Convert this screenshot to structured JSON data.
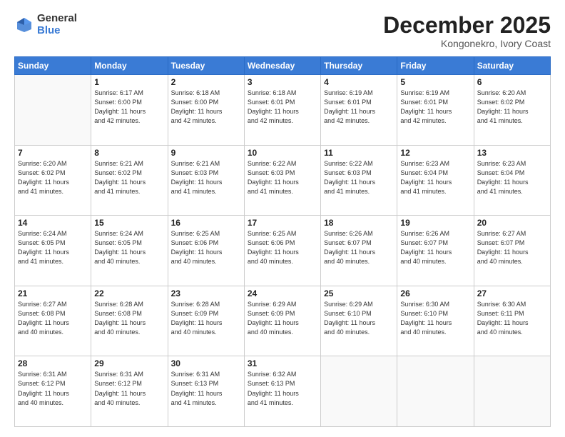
{
  "logo": {
    "general": "General",
    "blue": "Blue"
  },
  "header": {
    "month": "December 2025",
    "location": "Kongonekro, Ivory Coast"
  },
  "days_of_week": [
    "Sunday",
    "Monday",
    "Tuesday",
    "Wednesday",
    "Thursday",
    "Friday",
    "Saturday"
  ],
  "weeks": [
    [
      {
        "day": "",
        "info": ""
      },
      {
        "day": "1",
        "info": "Sunrise: 6:17 AM\nSunset: 6:00 PM\nDaylight: 11 hours\nand 42 minutes."
      },
      {
        "day": "2",
        "info": "Sunrise: 6:18 AM\nSunset: 6:00 PM\nDaylight: 11 hours\nand 42 minutes."
      },
      {
        "day": "3",
        "info": "Sunrise: 6:18 AM\nSunset: 6:01 PM\nDaylight: 11 hours\nand 42 minutes."
      },
      {
        "day": "4",
        "info": "Sunrise: 6:19 AM\nSunset: 6:01 PM\nDaylight: 11 hours\nand 42 minutes."
      },
      {
        "day": "5",
        "info": "Sunrise: 6:19 AM\nSunset: 6:01 PM\nDaylight: 11 hours\nand 42 minutes."
      },
      {
        "day": "6",
        "info": "Sunrise: 6:20 AM\nSunset: 6:02 PM\nDaylight: 11 hours\nand 41 minutes."
      }
    ],
    [
      {
        "day": "7",
        "info": "Sunrise: 6:20 AM\nSunset: 6:02 PM\nDaylight: 11 hours\nand 41 minutes."
      },
      {
        "day": "8",
        "info": "Sunrise: 6:21 AM\nSunset: 6:02 PM\nDaylight: 11 hours\nand 41 minutes."
      },
      {
        "day": "9",
        "info": "Sunrise: 6:21 AM\nSunset: 6:03 PM\nDaylight: 11 hours\nand 41 minutes."
      },
      {
        "day": "10",
        "info": "Sunrise: 6:22 AM\nSunset: 6:03 PM\nDaylight: 11 hours\nand 41 minutes."
      },
      {
        "day": "11",
        "info": "Sunrise: 6:22 AM\nSunset: 6:03 PM\nDaylight: 11 hours\nand 41 minutes."
      },
      {
        "day": "12",
        "info": "Sunrise: 6:23 AM\nSunset: 6:04 PM\nDaylight: 11 hours\nand 41 minutes."
      },
      {
        "day": "13",
        "info": "Sunrise: 6:23 AM\nSunset: 6:04 PM\nDaylight: 11 hours\nand 41 minutes."
      }
    ],
    [
      {
        "day": "14",
        "info": "Sunrise: 6:24 AM\nSunset: 6:05 PM\nDaylight: 11 hours\nand 41 minutes."
      },
      {
        "day": "15",
        "info": "Sunrise: 6:24 AM\nSunset: 6:05 PM\nDaylight: 11 hours\nand 40 minutes."
      },
      {
        "day": "16",
        "info": "Sunrise: 6:25 AM\nSunset: 6:06 PM\nDaylight: 11 hours\nand 40 minutes."
      },
      {
        "day": "17",
        "info": "Sunrise: 6:25 AM\nSunset: 6:06 PM\nDaylight: 11 hours\nand 40 minutes."
      },
      {
        "day": "18",
        "info": "Sunrise: 6:26 AM\nSunset: 6:07 PM\nDaylight: 11 hours\nand 40 minutes."
      },
      {
        "day": "19",
        "info": "Sunrise: 6:26 AM\nSunset: 6:07 PM\nDaylight: 11 hours\nand 40 minutes."
      },
      {
        "day": "20",
        "info": "Sunrise: 6:27 AM\nSunset: 6:07 PM\nDaylight: 11 hours\nand 40 minutes."
      }
    ],
    [
      {
        "day": "21",
        "info": "Sunrise: 6:27 AM\nSunset: 6:08 PM\nDaylight: 11 hours\nand 40 minutes."
      },
      {
        "day": "22",
        "info": "Sunrise: 6:28 AM\nSunset: 6:08 PM\nDaylight: 11 hours\nand 40 minutes."
      },
      {
        "day": "23",
        "info": "Sunrise: 6:28 AM\nSunset: 6:09 PM\nDaylight: 11 hours\nand 40 minutes."
      },
      {
        "day": "24",
        "info": "Sunrise: 6:29 AM\nSunset: 6:09 PM\nDaylight: 11 hours\nand 40 minutes."
      },
      {
        "day": "25",
        "info": "Sunrise: 6:29 AM\nSunset: 6:10 PM\nDaylight: 11 hours\nand 40 minutes."
      },
      {
        "day": "26",
        "info": "Sunrise: 6:30 AM\nSunset: 6:10 PM\nDaylight: 11 hours\nand 40 minutes."
      },
      {
        "day": "27",
        "info": "Sunrise: 6:30 AM\nSunset: 6:11 PM\nDaylight: 11 hours\nand 40 minutes."
      }
    ],
    [
      {
        "day": "28",
        "info": "Sunrise: 6:31 AM\nSunset: 6:12 PM\nDaylight: 11 hours\nand 40 minutes."
      },
      {
        "day": "29",
        "info": "Sunrise: 6:31 AM\nSunset: 6:12 PM\nDaylight: 11 hours\nand 40 minutes."
      },
      {
        "day": "30",
        "info": "Sunrise: 6:31 AM\nSunset: 6:13 PM\nDaylight: 11 hours\nand 41 minutes."
      },
      {
        "day": "31",
        "info": "Sunrise: 6:32 AM\nSunset: 6:13 PM\nDaylight: 11 hours\nand 41 minutes."
      },
      {
        "day": "",
        "info": ""
      },
      {
        "day": "",
        "info": ""
      },
      {
        "day": "",
        "info": ""
      }
    ]
  ]
}
